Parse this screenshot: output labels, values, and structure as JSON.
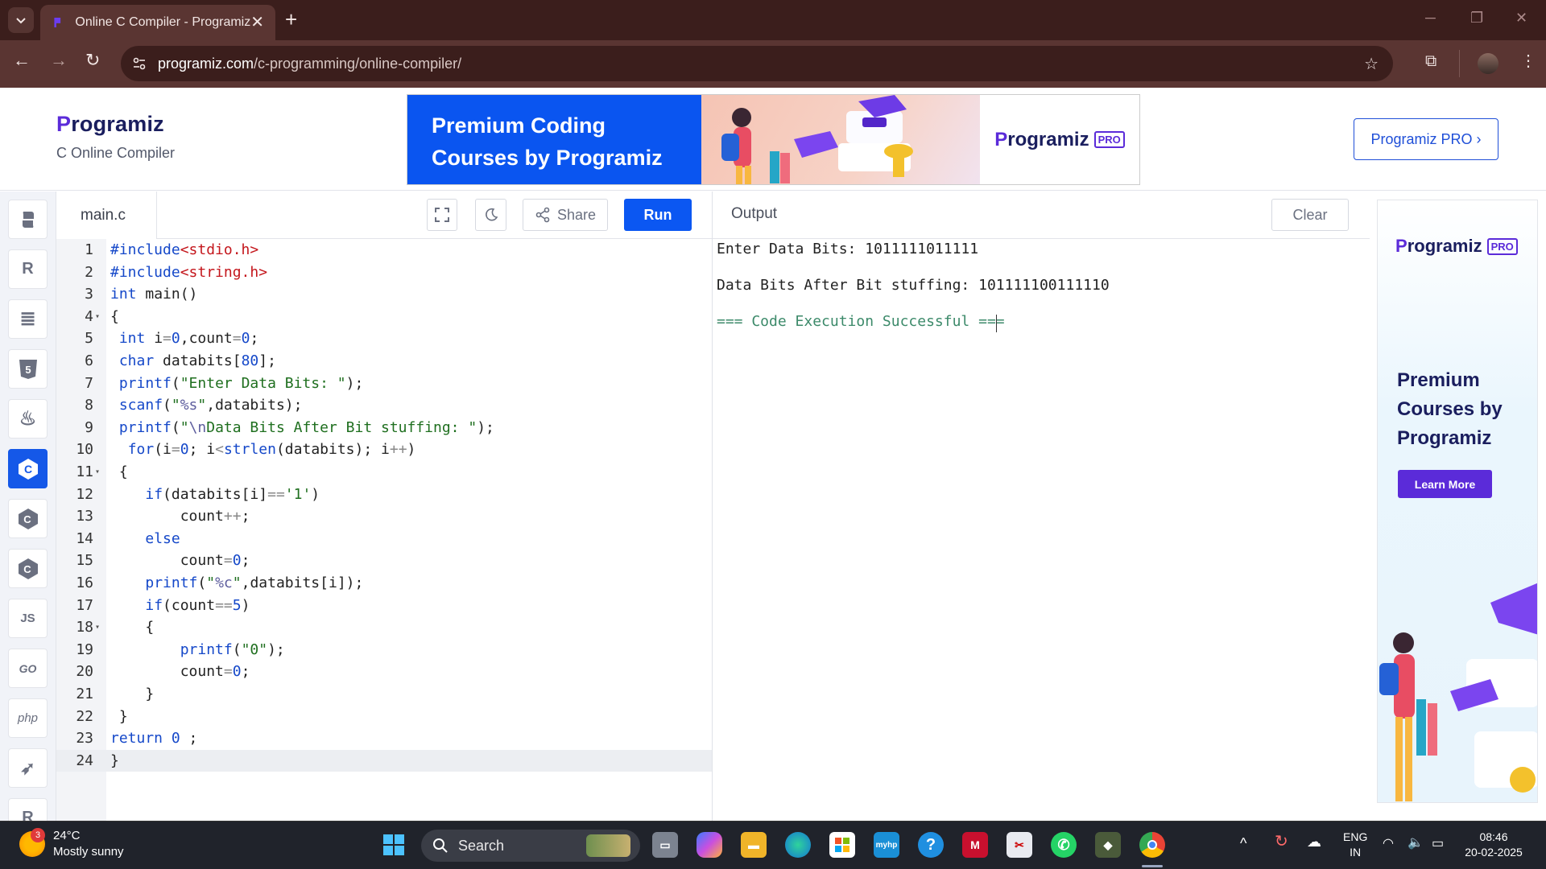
{
  "browser": {
    "tab_title": "Online C Compiler - Programiz",
    "url_host": "programiz.com",
    "url_path": "/c-programming/online-compiler/"
  },
  "header": {
    "brand": "rogramiz",
    "brand_initial": "P",
    "subtitle": "C Online Compiler",
    "ad_line1": "Premium Coding",
    "ad_line2": "Courses by Programiz",
    "ad_logo_initial": "P",
    "ad_logo": "rogramiz",
    "ad_logo_badge": "PRO",
    "pro_button": "Programiz PRO ›"
  },
  "languages": [
    {
      "name": "python",
      "glyph": "🐍"
    },
    {
      "name": "r",
      "glyph": "R"
    },
    {
      "name": "sql",
      "glyph": "≣"
    },
    {
      "name": "html",
      "glyph": "5"
    },
    {
      "name": "java",
      "glyph": "♨"
    },
    {
      "name": "c",
      "glyph": "C"
    },
    {
      "name": "cpp",
      "glyph": "C"
    },
    {
      "name": "csharp",
      "glyph": "C"
    },
    {
      "name": "js",
      "glyph": "JS"
    },
    {
      "name": "go",
      "glyph": "GO"
    },
    {
      "name": "php",
      "glyph": "php"
    },
    {
      "name": "swift",
      "glyph": "➶"
    },
    {
      "name": "rust",
      "glyph": "R"
    }
  ],
  "editor": {
    "file_name": "main.c",
    "share_label": "Share",
    "run_label": "Run",
    "lines": [
      "#include<stdio.h>",
      "#include<string.h>",
      "int main()",
      "{",
      " int i=0,count=0;",
      " char databits[80];",
      " printf(\"Enter Data Bits: \");",
      " scanf(\"%s\",databits);",
      " printf(\"\\nData Bits After Bit stuffing: \");",
      "  for(i=0; i<strlen(databits); i++)",
      " {",
      "    if(databits[i]=='1')",
      "        count++;",
      "    else",
      "        count=0;",
      "    printf(\"%c\",databits[i]);",
      "    if(count==5)",
      "    {",
      "        printf(\"0\");",
      "        count=0;",
      "    }",
      " }",
      "return 0 ;",
      "}"
    ],
    "fold_lines": [
      4,
      11,
      18
    ],
    "current_line": 24
  },
  "output": {
    "title": "Output",
    "clear_label": "Clear",
    "lines": [
      "Enter Data Bits: 1011111011111",
      "",
      "Data Bits After Bit stuffing: 101111100111110",
      "",
      "=== Code Execution Successful ==="
    ]
  },
  "side_ad": {
    "logo_initial": "P",
    "logo": "rogramiz",
    "badge": "PRO",
    "headline": "Premium Courses by Programiz",
    "cta": "Learn More"
  },
  "taskbar": {
    "weather_badge": "3",
    "temperature": "24°C",
    "weather": "Mostly sunny",
    "search_label": "Search",
    "language": "ENG",
    "region": "IN",
    "time": "08:46",
    "date": "20-02-2025"
  },
  "colors": {
    "run_button": "#0b57f2",
    "active_language": "#1558e8",
    "brand_purple": "#5b2bd9",
    "chrome_dark": "#3b1e1c"
  }
}
